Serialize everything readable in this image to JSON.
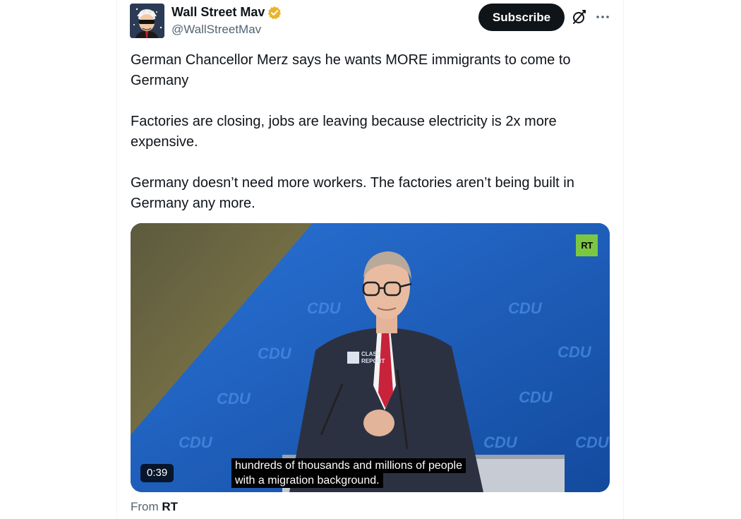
{
  "tweet": {
    "author": {
      "display_name": "Wall Street Mav",
      "handle": "@WallStreetMav",
      "verified": true,
      "verified_color": "#e8b42c"
    },
    "subscribe_label": "Subscribe",
    "paragraphs": [
      "German Chancellor Merz says he wants MORE immigrants to come to Germany",
      "Factories are closing, jobs are leaving because electricity is 2x more expensive.",
      "Germany doesn’t need more workers. The factories aren’t being built in Germany any more."
    ],
    "media": {
      "duration": "0:39",
      "subtitle_lines": [
        "hundreds of thousands and millions of people",
        "with a migration background."
      ],
      "broadcaster_logo": "RT",
      "watermark": "CLASH REPORT",
      "backdrop_text": "CDU"
    },
    "source": {
      "prefix": "From",
      "name": "RT"
    }
  },
  "icons": {
    "grok": "grok-icon",
    "more": "more-icon",
    "verified": "verified-badge-icon"
  },
  "colors": {
    "text": "#0f1419",
    "secondary_text": "#536471",
    "button_bg": "#0f1419",
    "video_blue": "#1a58b8",
    "rt_green": "#7cc742"
  }
}
